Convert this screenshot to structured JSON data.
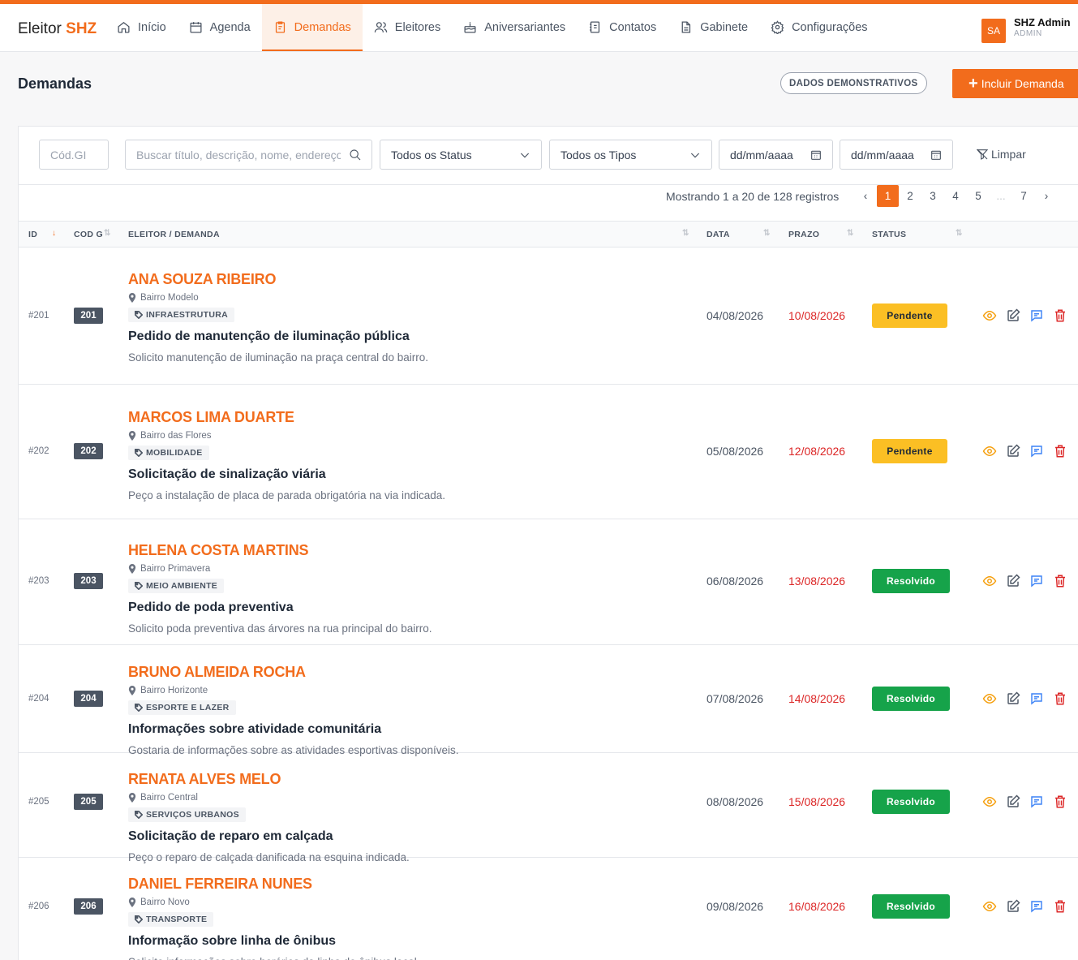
{
  "app": {
    "brand": "Eleitor",
    "brand_accent": "SHZ",
    "accent_color": "#f26c1c"
  },
  "nav": [
    {
      "label": "Início",
      "icon": "home-icon"
    },
    {
      "label": "Agenda",
      "icon": "calendar-icon"
    },
    {
      "label": "Demandas",
      "icon": "clipboard-icon",
      "active": true
    },
    {
      "label": "Eleitores",
      "icon": "users-icon"
    },
    {
      "label": "Aniversariantes",
      "icon": "cake-icon"
    },
    {
      "label": "Contatos",
      "icon": "contacts-icon"
    },
    {
      "label": "Gabinete",
      "icon": "document-icon"
    },
    {
      "label": "Configurações",
      "icon": "gear-icon"
    }
  ],
  "user": {
    "initials": "SA",
    "name": "SHZ Admin",
    "role": "ADMIN"
  },
  "page": {
    "title": "Demandas",
    "demo_badge": "DADOS DEMONSTRATIVOS",
    "add_button": "Incluir Demanda"
  },
  "filters": {
    "cod_placeholder": "Cód.GI",
    "search_placeholder": "Buscar título, descrição, nome, endereço",
    "status_select": "Todos os Status",
    "type_select": "Todos os Tipos",
    "date_from": "dd/mm/aaaa",
    "date_to": "dd/mm/aaaa",
    "clear": "Limpar"
  },
  "pagination": {
    "showing": "Mostrando 1 a 20 de 128 registros",
    "pages": [
      "1",
      "2",
      "3",
      "4",
      "5",
      "...",
      "7"
    ],
    "current": "1"
  },
  "table": {
    "headers": {
      "id": "ID",
      "codg": "COD G",
      "voter": "ELEITOR / DEMANDA",
      "date": "DATA",
      "deadline": "PRAZO",
      "status": "STATUS"
    },
    "rows": [
      {
        "id": "#201",
        "codg": "201",
        "voter": "ANA SOUZA RIBEIRO",
        "neighborhood": "Bairro Modelo",
        "tag": "INFRAESTRUTURA",
        "title": "Pedido de manutenção de iluminação pública",
        "description": "Solicito manutenção de iluminação na praça central do bairro.",
        "date": "04/08/2026",
        "deadline": "10/08/2026",
        "status": "Pendente"
      },
      {
        "id": "#202",
        "codg": "202",
        "voter": "MARCOS LIMA DUARTE",
        "neighborhood": "Bairro das Flores",
        "tag": "MOBILIDADE",
        "title": "Solicitação de sinalização viária",
        "description": "Peço a instalação de placa de parada obrigatória na via indicada.",
        "date": "05/08/2026",
        "deadline": "12/08/2026",
        "status": "Pendente"
      },
      {
        "id": "#203",
        "codg": "203",
        "voter": "HELENA COSTA MARTINS",
        "neighborhood": "Bairro Primavera",
        "tag": "MEIO AMBIENTE",
        "title": "Pedido de poda preventiva",
        "description": "Solicito poda preventiva das árvores na rua principal do bairro.",
        "date": "06/08/2026",
        "deadline": "13/08/2026",
        "status": "Resolvido"
      },
      {
        "id": "#204",
        "codg": "204",
        "voter": "BRUNO ALMEIDA ROCHA",
        "neighborhood": "Bairro Horizonte",
        "tag": "ESPORTE E LAZER",
        "title": "Informações sobre atividade comunitária",
        "description": "Gostaria de informações sobre as atividades esportivas disponíveis.",
        "date": "07/08/2026",
        "deadline": "14/08/2026",
        "status": "Resolvido"
      },
      {
        "id": "#205",
        "codg": "205",
        "voter": "RENATA ALVES MELO",
        "neighborhood": "Bairro Central",
        "tag": "SERVIÇOS URBANOS",
        "title": "Solicitação de reparo em calçada",
        "description": "Peço o reparo de calçada danificada na esquina indicada.",
        "date": "08/08/2026",
        "deadline": "15/08/2026",
        "status": "Resolvido"
      },
      {
        "id": "#206",
        "codg": "206",
        "voter": "DANIEL FERREIRA NUNES",
        "neighborhood": "Bairro Novo",
        "tag": "TRANSPORTE",
        "title": "Informação sobre linha de ônibus",
        "description": "Solicito informações sobre horários da linha de ônibus local.",
        "date": "09/08/2026",
        "deadline": "16/08/2026",
        "status": "Resolvido"
      }
    ]
  }
}
